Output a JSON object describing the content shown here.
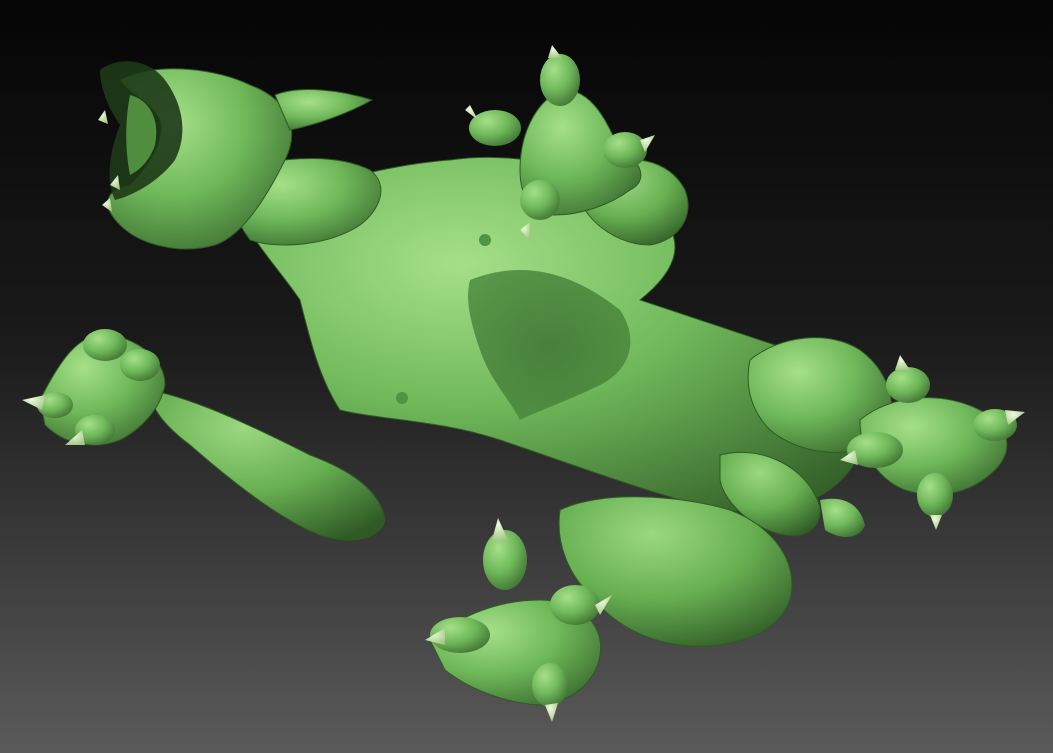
{
  "scene": {
    "subject": "green-sculpted-creature",
    "colors": {
      "background_top": "#050505",
      "background_bottom": "#5a5a5a",
      "clay_base": "#6fb85a",
      "clay_light": "#a6e089",
      "clay_mid": "#5ea24b",
      "clay_dark": "#2f5a25",
      "clay_shadow": "#1f3b19",
      "claw": "#cfe8b0",
      "mouth": "#1e3a18"
    }
  }
}
